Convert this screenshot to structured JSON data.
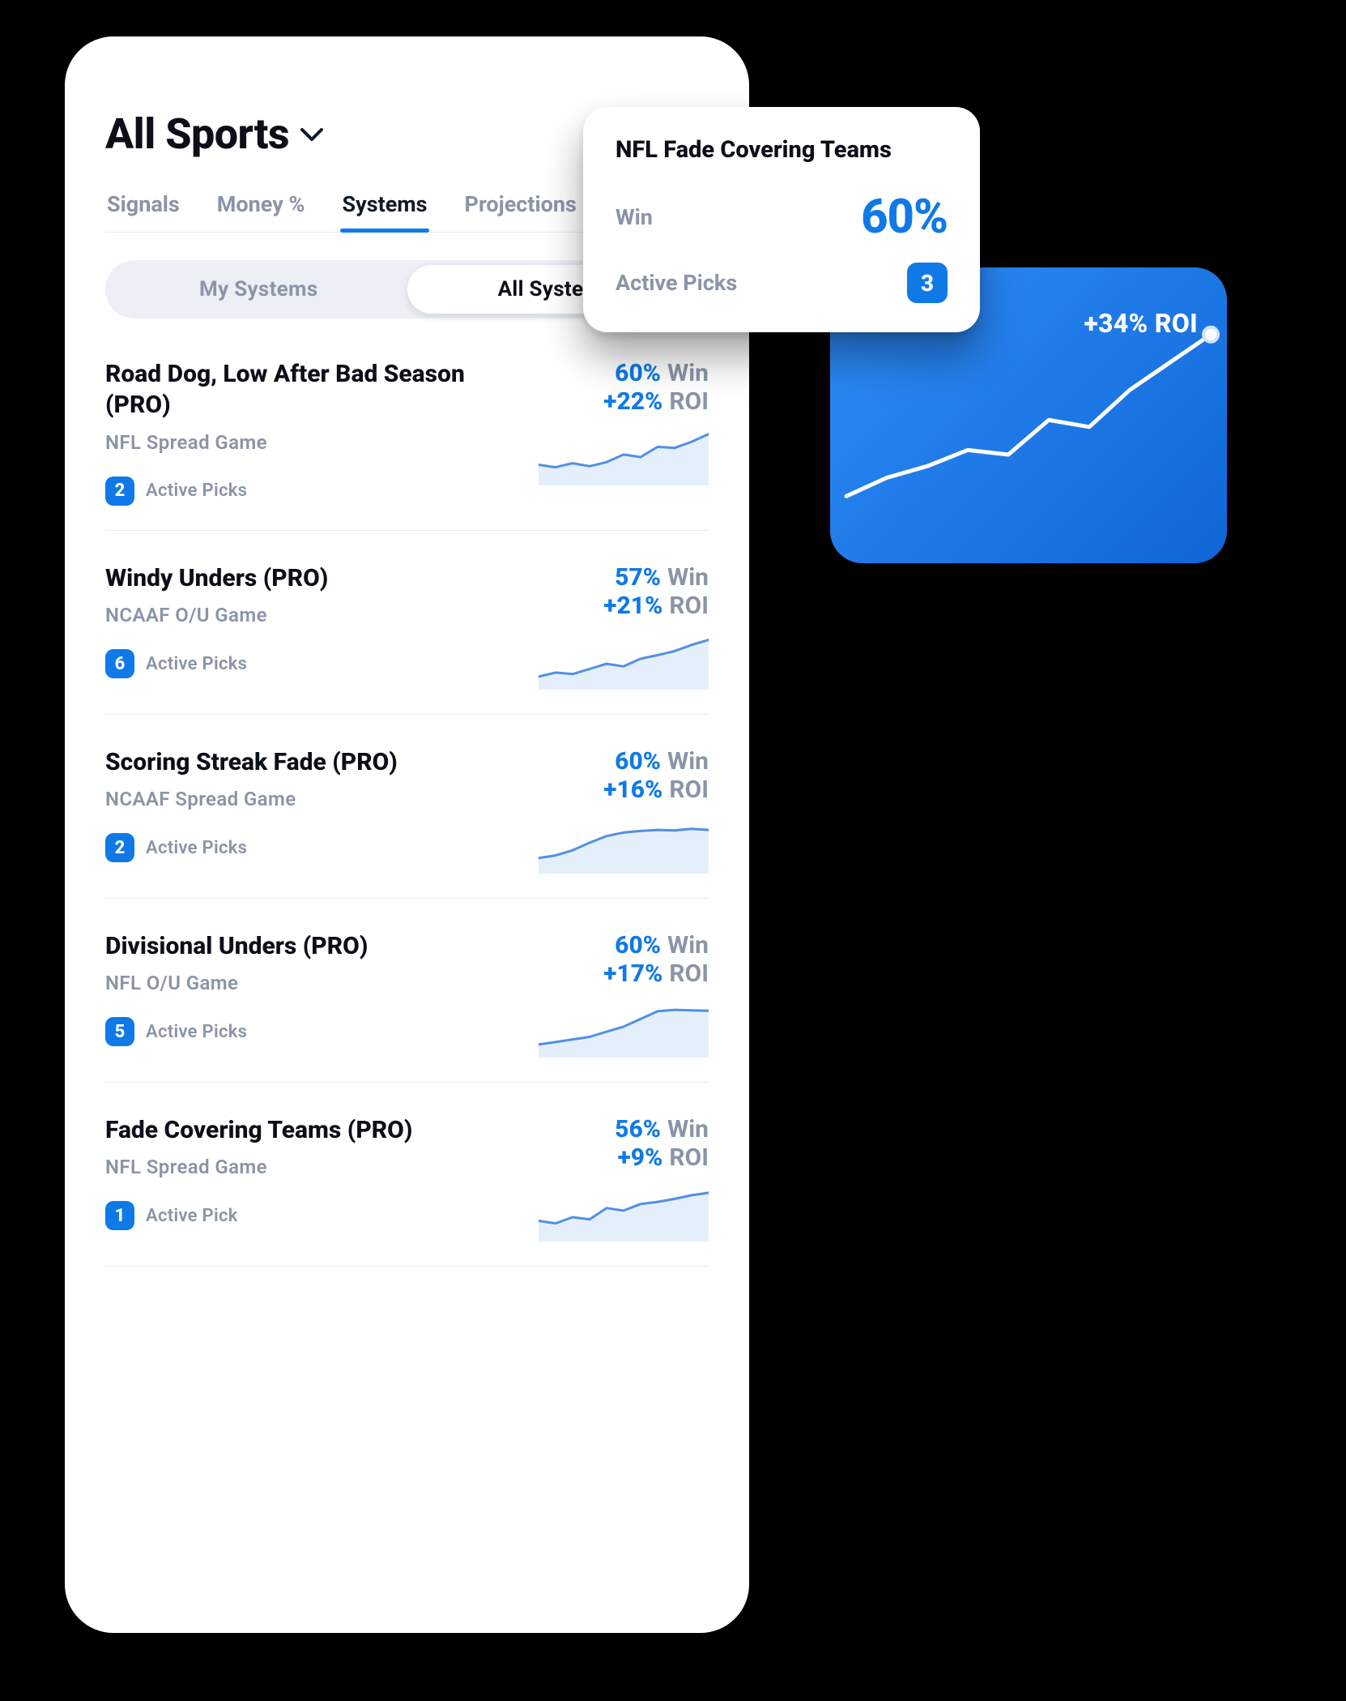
{
  "header": {
    "title": "All Sports"
  },
  "tabs": [
    {
      "id": "signals",
      "label": "Signals",
      "active": false
    },
    {
      "id": "money",
      "label": "Money %",
      "active": false
    },
    {
      "id": "systems",
      "label": "Systems",
      "active": true
    },
    {
      "id": "projections",
      "label": "Projections",
      "active": false,
      "truncated": true
    }
  ],
  "segmented": {
    "options": [
      {
        "id": "my",
        "label": "My Systems",
        "active": false
      },
      {
        "id": "all",
        "label": "All Systems",
        "active": true
      }
    ]
  },
  "systems": [
    {
      "name": "Road Dog, Low After Bad Season (PRO)",
      "subtitle": "NFL Spread Game",
      "active_picks": 2,
      "picks_label": "Active Picks",
      "win_pct": "60%",
      "roi": "+22%",
      "spark": [
        0.35,
        0.3,
        0.38,
        0.32,
        0.4,
        0.55,
        0.5,
        0.7,
        0.68,
        0.8,
        0.95
      ]
    },
    {
      "name": "Windy Unders (PRO)",
      "subtitle": "NCAAF O/U Game",
      "active_picks": 6,
      "picks_label": "Active Picks",
      "win_pct": "57%",
      "roi": "+21%",
      "spark": [
        0.2,
        0.28,
        0.25,
        0.35,
        0.45,
        0.4,
        0.55,
        0.62,
        0.7,
        0.82,
        0.92
      ]
    },
    {
      "name": "Scoring Streak Fade (PRO)",
      "subtitle": "NCAAF Spread Game",
      "active_picks": 2,
      "picks_label": "Active Picks",
      "win_pct": "60%",
      "roi": "+16%",
      "spark": [
        0.25,
        0.3,
        0.4,
        0.55,
        0.68,
        0.75,
        0.78,
        0.8,
        0.79,
        0.82,
        0.8
      ]
    },
    {
      "name": "Divisional Unders (PRO)",
      "subtitle": "NFL O/U Game",
      "active_picks": 5,
      "picks_label": "Active Picks",
      "win_pct": "60%",
      "roi": "+17%",
      "spark": [
        0.2,
        0.25,
        0.3,
        0.35,
        0.45,
        0.55,
        0.7,
        0.85,
        0.88,
        0.87,
        0.86
      ]
    },
    {
      "name": "Fade Covering Teams (PRO)",
      "subtitle": "NFL Spread Game",
      "active_picks": 1,
      "picks_label": "Active Pick",
      "win_pct": "56%",
      "roi": "+9%",
      "spark": [
        0.35,
        0.3,
        0.42,
        0.38,
        0.6,
        0.55,
        0.68,
        0.72,
        0.78,
        0.85,
        0.9
      ]
    }
  ],
  "labels": {
    "win": "Win",
    "roi": "ROI"
  },
  "popover": {
    "title": "NFL Fade Covering Teams",
    "win_label": "Win",
    "win_value": "60%",
    "picks_label": "Active Picks",
    "picks_value": 3
  },
  "roi_tile": {
    "label": "+34% ROI",
    "line": [
      0.22,
      0.3,
      0.35,
      0.42,
      0.4,
      0.55,
      0.52,
      0.68,
      0.8,
      0.92
    ],
    "dot_index": 9
  }
}
